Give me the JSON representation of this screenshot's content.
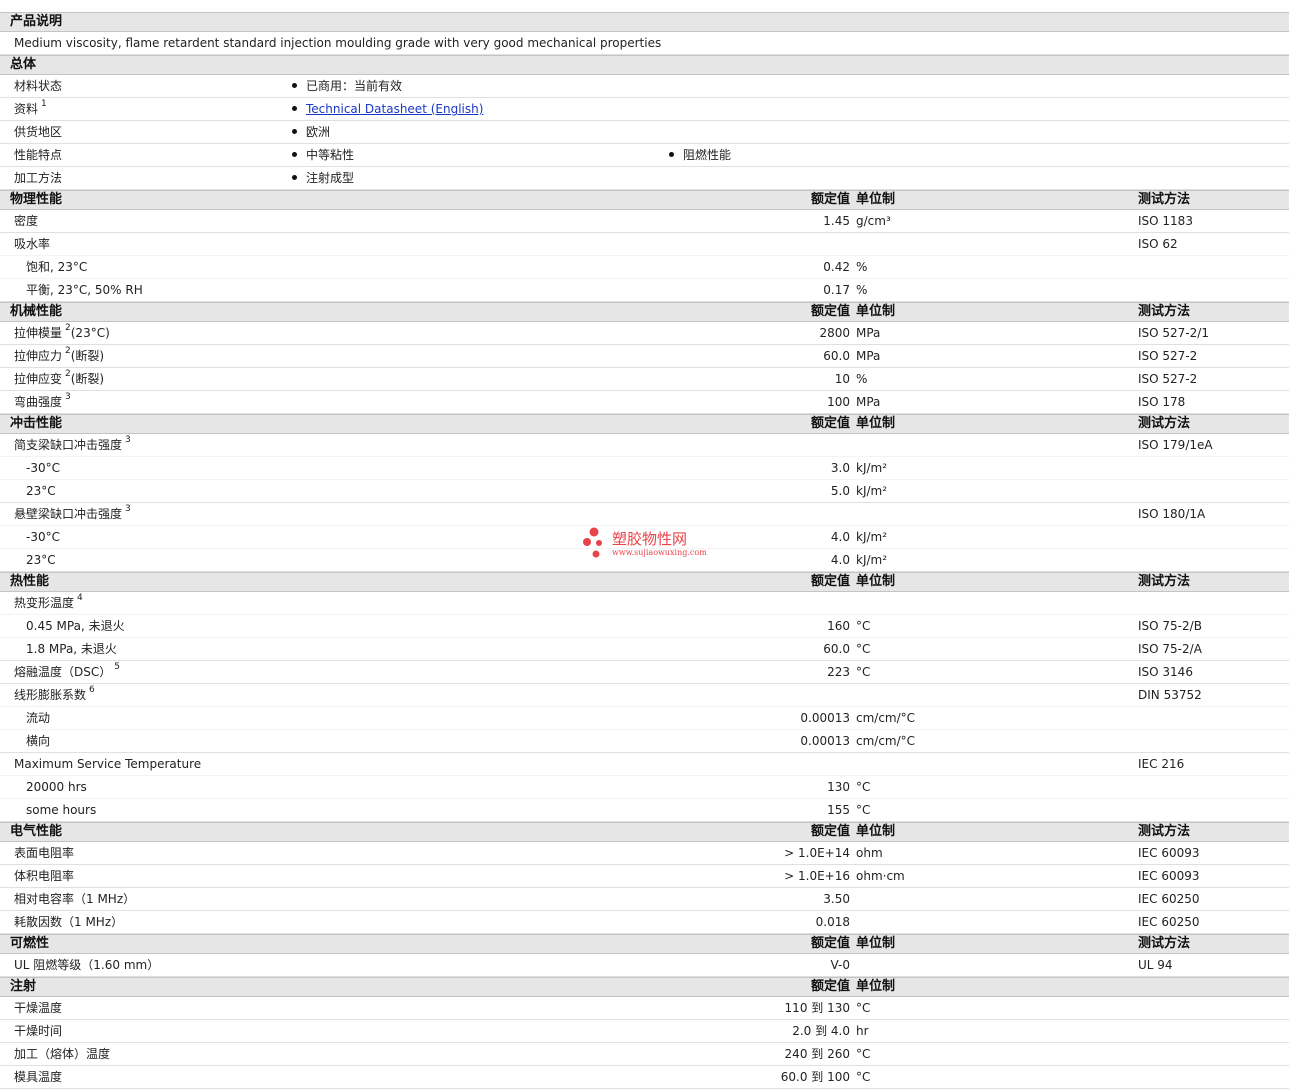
{
  "description": {
    "header": "产品说明",
    "text": "Medium viscosity, flame retardent standard injection moulding grade with very good mechanical properties"
  },
  "general": {
    "header": "总体",
    "rows": [
      {
        "label": "材料状态",
        "sup": "",
        "values": [
          "已商用：当前有效"
        ]
      },
      {
        "label": "资料",
        "sup": "1",
        "values": [
          "Technical Datasheet (English)"
        ],
        "link": true
      },
      {
        "label": "供货地区",
        "sup": "",
        "values": [
          "欧洲"
        ]
      },
      {
        "label": "性能特点",
        "sup": "",
        "values": [
          "中等粘性",
          "阻燃性能"
        ]
      },
      {
        "label": "加工方法",
        "sup": "",
        "values": [
          "注射成型"
        ]
      }
    ]
  },
  "columns": {
    "value": "额定值",
    "unit": "单位制",
    "test": "测试方法"
  },
  "sections": [
    {
      "title": "物理性能",
      "show_test_header": true,
      "rows": [
        {
          "label": "密度",
          "sup": "",
          "sub": false,
          "value": "1.45",
          "unit": "g/cm³",
          "test": "ISO 1183"
        },
        {
          "label": "吸水率",
          "sup": "",
          "sub": false,
          "value": "",
          "unit": "",
          "test": "ISO 62"
        },
        {
          "label": "饱和, 23°C",
          "sup": "",
          "sub": true,
          "value": "0.42",
          "unit": "%",
          "test": ""
        },
        {
          "label": "平衡, 23°C, 50% RH",
          "sup": "",
          "sub": true,
          "value": "0.17",
          "unit": "%",
          "test": ""
        }
      ]
    },
    {
      "title": "机械性能",
      "show_test_header": true,
      "rows": [
        {
          "label": "拉伸模量",
          "sup": "2",
          "suffix": "(23°C)",
          "sub": false,
          "value": "2800",
          "unit": "MPa",
          "test": "ISO 527-2/1"
        },
        {
          "label": "拉伸应力",
          "sup": "2",
          "suffix": "(断裂)",
          "sub": false,
          "value": "60.0",
          "unit": "MPa",
          "test": "ISO 527-2"
        },
        {
          "label": "拉伸应变",
          "sup": "2",
          "suffix": "(断裂)",
          "sub": false,
          "value": "10",
          "unit": "%",
          "test": "ISO 527-2"
        },
        {
          "label": "弯曲强度",
          "sup": "3",
          "sub": false,
          "value": "100",
          "unit": "MPa",
          "test": "ISO 178"
        }
      ]
    },
    {
      "title": "冲击性能",
      "show_test_header": true,
      "rows": [
        {
          "label": "简支梁缺口冲击强度",
          "sup": "3",
          "sub": false,
          "value": "",
          "unit": "",
          "test": "ISO 179/1eA"
        },
        {
          "label": "-30°C",
          "sup": "",
          "sub": true,
          "value": "3.0",
          "unit": "kJ/m²",
          "test": ""
        },
        {
          "label": "23°C",
          "sup": "",
          "sub": true,
          "value": "5.0",
          "unit": "kJ/m²",
          "test": ""
        },
        {
          "label": "悬壁梁缺口冲击强度",
          "sup": "3",
          "sub": false,
          "value": "",
          "unit": "",
          "test": "ISO 180/1A"
        },
        {
          "label": "-30°C",
          "sup": "",
          "sub": true,
          "value": "4.0",
          "unit": "kJ/m²",
          "test": ""
        },
        {
          "label": "23°C",
          "sup": "",
          "sub": true,
          "value": "4.0",
          "unit": "kJ/m²",
          "test": ""
        }
      ]
    },
    {
      "title": "热性能",
      "show_test_header": true,
      "rows": [
        {
          "label": "热变形温度",
          "sup": "4",
          "sub": false,
          "value": "",
          "unit": "",
          "test": ""
        },
        {
          "label": "0.45 MPa, 未退火",
          "sup": "",
          "sub": true,
          "value": "160",
          "unit": "°C",
          "test": "ISO 75-2/B"
        },
        {
          "label": "1.8 MPa, 未退火",
          "sup": "",
          "sub": true,
          "value": "60.0",
          "unit": "°C",
          "test": "ISO 75-2/A"
        },
        {
          "label": "熔融温度（DSC）",
          "sup": "5",
          "sub": false,
          "value": "223",
          "unit": "°C",
          "test": "ISO 3146"
        },
        {
          "label": "线形膨胀系数",
          "sup": "6",
          "sub": false,
          "value": "",
          "unit": "",
          "test": "DIN 53752"
        },
        {
          "label": "流动",
          "sup": "",
          "sub": true,
          "value": "0.00013",
          "unit": "cm/cm/°C",
          "test": ""
        },
        {
          "label": "横向",
          "sup": "",
          "sub": true,
          "value": "0.00013",
          "unit": "cm/cm/°C",
          "test": ""
        },
        {
          "label": "Maximum Service Temperature",
          "sup": "",
          "sub": false,
          "value": "",
          "unit": "",
          "test": "IEC 216"
        },
        {
          "label": "20000 hrs",
          "sup": "",
          "sub": true,
          "value": "130",
          "unit": "°C",
          "test": ""
        },
        {
          "label": "some hours",
          "sup": "",
          "sub": true,
          "value": "155",
          "unit": "°C",
          "test": ""
        }
      ]
    },
    {
      "title": "电气性能",
      "show_test_header": true,
      "rows": [
        {
          "label": "表面电阻率",
          "sup": "",
          "sub": false,
          "value": "> 1.0E+14",
          "unit": "ohm",
          "test": "IEC 60093"
        },
        {
          "label": "体积电阻率",
          "sup": "",
          "sub": false,
          "value": "> 1.0E+16",
          "unit": "ohm·cm",
          "test": "IEC 60093"
        },
        {
          "label": "相对电容率（1 MHz）",
          "sup": "",
          "sub": false,
          "value": "3.50",
          "unit": "",
          "test": "IEC 60250"
        },
        {
          "label": "耗散因数（1 MHz）",
          "sup": "",
          "sub": false,
          "value": "0.018",
          "unit": "",
          "test": "IEC 60250"
        }
      ]
    },
    {
      "title": "可燃性",
      "show_test_header": true,
      "rows": [
        {
          "label": "UL 阻燃等级（1.60 mm）",
          "sup": "",
          "sub": false,
          "value": "V-0",
          "unit": "",
          "test": "UL 94"
        }
      ]
    },
    {
      "title": "注射",
      "show_test_header": false,
      "rows": [
        {
          "label": "干燥温度",
          "sup": "",
          "sub": false,
          "value": "110 到  130",
          "unit": "°C",
          "test": ""
        },
        {
          "label": "干燥时间",
          "sup": "",
          "sub": false,
          "value": "2.0 到  4.0",
          "unit": "hr",
          "test": ""
        },
        {
          "label": "加工（熔体）温度",
          "sup": "",
          "sub": false,
          "value": "240 到  260",
          "unit": "°C",
          "test": ""
        },
        {
          "label": "模具温度",
          "sup": "",
          "sub": false,
          "value": "60.0 到  100",
          "unit": "°C",
          "test": ""
        }
      ]
    }
  ],
  "watermark": {
    "title": "塑胶物性网",
    "url": "www.sujiaowuxing.com",
    "color": "#e8434a"
  }
}
